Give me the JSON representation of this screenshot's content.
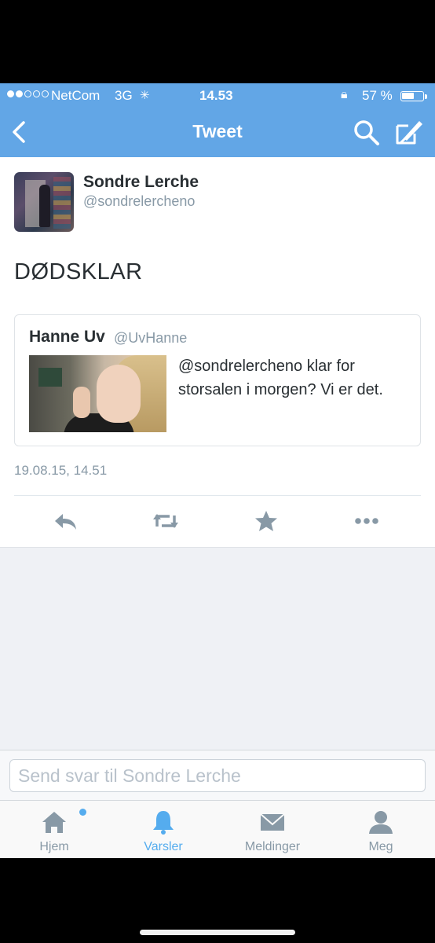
{
  "status_bar": {
    "carrier": "NetCom",
    "network": "3G",
    "time": "14.53",
    "battery_percent": "57 %",
    "battery_level": 0.57,
    "signal_bars_filled": 2,
    "signal_bars_total": 5
  },
  "nav": {
    "title": "Tweet",
    "icons": [
      "back-icon",
      "search-icon",
      "compose-icon"
    ]
  },
  "tweet": {
    "author_name": "Sondre Lerche",
    "author_handle": "@sondrelercheno",
    "text": "DØDSKLAR",
    "timestamp": "19.08.15, 14.51",
    "quoted": {
      "author_name": "Hanne Uv",
      "author_handle": "@UvHanne",
      "text": "@sondrelercheno klar for storsalen i morgen? Vi er det."
    },
    "actions": [
      "reply-icon",
      "retweet-icon",
      "favorite-icon",
      "more-icon"
    ]
  },
  "reply": {
    "placeholder": "Send svar til Sondre Lerche"
  },
  "tabs": [
    {
      "label": "Hjem",
      "icon": "home-icon",
      "notification": true
    },
    {
      "label": "Varsler",
      "icon": "bell-icon",
      "active": true
    },
    {
      "label": "Meldinger",
      "icon": "envelope-icon"
    },
    {
      "label": "Meg",
      "icon": "person-icon"
    }
  ],
  "colors": {
    "header_blue": "#62a6e6",
    "accent_blue": "#55acee",
    "text_dark": "#292f33",
    "text_gray": "#8899a6",
    "icon_gray": "#8899a6"
  }
}
